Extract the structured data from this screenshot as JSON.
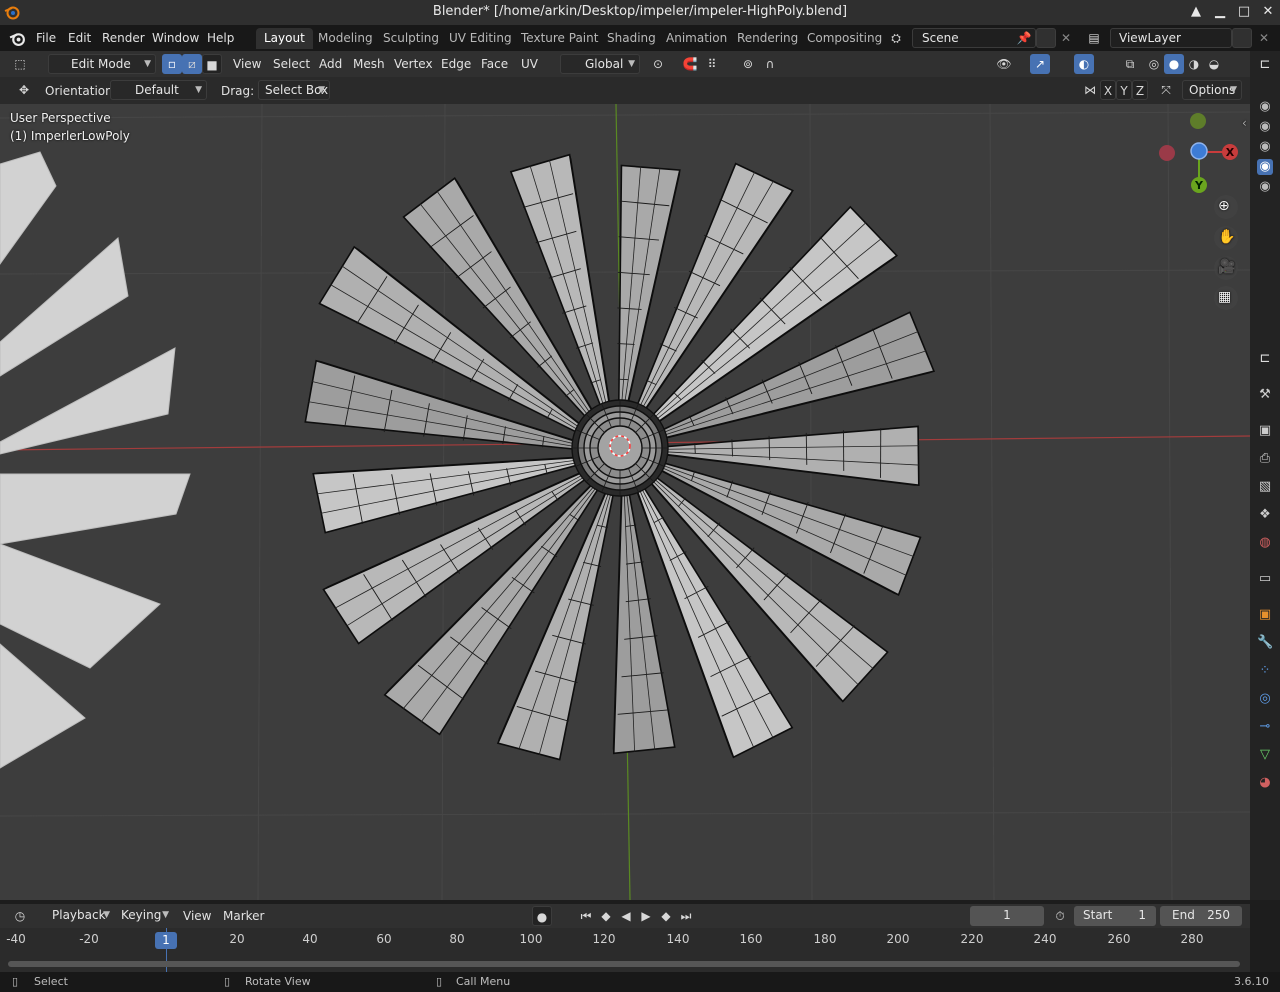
{
  "window": {
    "title": "Blender* [/home/arkin/Desktop/impeler/impeler-HighPoly.blend]"
  },
  "menu": {
    "file": "File",
    "edit": "Edit",
    "render": "Render",
    "window": "Window",
    "help": "Help"
  },
  "workspaces": [
    "Layout",
    "Modeling",
    "Sculpting",
    "UV Editing",
    "Texture Paint",
    "Shading",
    "Animation",
    "Rendering",
    "Compositing"
  ],
  "scene": {
    "name": "Scene",
    "view_layer": "ViewLayer"
  },
  "viewport_header": {
    "mode": "Edit Mode",
    "view": "View",
    "select": "Select",
    "add": "Add",
    "mesh": "Mesh",
    "vertex": "Vertex",
    "edge": "Edge",
    "face": "Face",
    "uv": "UV",
    "transform_orientation": "Global"
  },
  "tool_header": {
    "orientation_label": "Orientation:",
    "orientation_value": "Default",
    "drag_label": "Drag:",
    "drag_value": "Select Box",
    "axis_x": "X",
    "axis_y": "Y",
    "axis_z": "Z",
    "options": "Options"
  },
  "viewport": {
    "perspective": "User Perspective",
    "object": "(1) ImperlerLowPoly",
    "gizmo": {
      "x": "X",
      "y": "Y"
    },
    "blade_count": 17
  },
  "timeline": {
    "playback": "Playback",
    "keying": "Keying",
    "view": "View",
    "marker": "Marker",
    "current_frame": "1",
    "start_label": "Start",
    "start_value": "1",
    "end_label": "End",
    "end_value": "250",
    "ticks": [
      "-40",
      "-20",
      "1",
      "20",
      "40",
      "60",
      "80",
      "100",
      "120",
      "140",
      "160",
      "180",
      "200",
      "220",
      "240",
      "260",
      "280"
    ]
  },
  "statusbar": {
    "select": "Select",
    "rotate": "Rotate View",
    "call_menu": "Call Menu",
    "version": "3.6.10"
  },
  "colors": {
    "accent": "#4772b3",
    "x_axis": "#c83c3c",
    "y_axis": "#6aa51e",
    "z_axis": "#3d7cd6"
  }
}
